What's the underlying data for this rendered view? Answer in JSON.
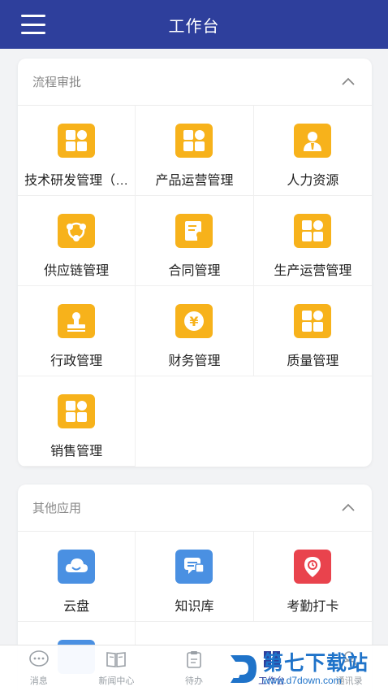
{
  "header": {
    "title": "工作台",
    "menu_icon": "menu-icon"
  },
  "sections": [
    {
      "title": "流程审批",
      "items": [
        {
          "label": "技术研发管理（…",
          "icon": "grid-icon"
        },
        {
          "label": "产品运营管理",
          "icon": "grid-icon"
        },
        {
          "label": "人力资源",
          "icon": "person-icon"
        },
        {
          "label": "供应链管理",
          "icon": "chain-icon"
        },
        {
          "label": "合同管理",
          "icon": "contract-icon"
        },
        {
          "label": "生产运营管理",
          "icon": "grid-icon"
        },
        {
          "label": "行政管理",
          "icon": "stamp-icon"
        },
        {
          "label": "财务管理",
          "icon": "yen-icon"
        },
        {
          "label": "质量管理",
          "icon": "grid-icon"
        },
        {
          "label": "销售管理",
          "icon": "grid-icon"
        }
      ]
    },
    {
      "title": "其他应用",
      "items": [
        {
          "label": "云盘",
          "icon": "cloud-icon"
        },
        {
          "label": "知识库",
          "icon": "chat-icon"
        },
        {
          "label": "考勤打卡",
          "icon": "location-icon"
        }
      ]
    }
  ],
  "bottom_nav": [
    {
      "label": "消息",
      "icon": "message-icon"
    },
    {
      "label": "新闻中心",
      "icon": "book-icon"
    },
    {
      "label": "待办",
      "icon": "clipboard-icon"
    },
    {
      "label": "工作台",
      "icon": "workbench-icon"
    },
    {
      "label": "通讯录",
      "icon": "contacts-icon"
    }
  ],
  "watermark": {
    "main": "第七下载站",
    "sub": "www.d7down.com"
  },
  "colors": {
    "header": "#2e3f9c",
    "orange_icon": "#f7b21b",
    "blue_icon": "#4a90e2",
    "red_icon": "#e9434d",
    "watermark": "#1f73c9"
  }
}
